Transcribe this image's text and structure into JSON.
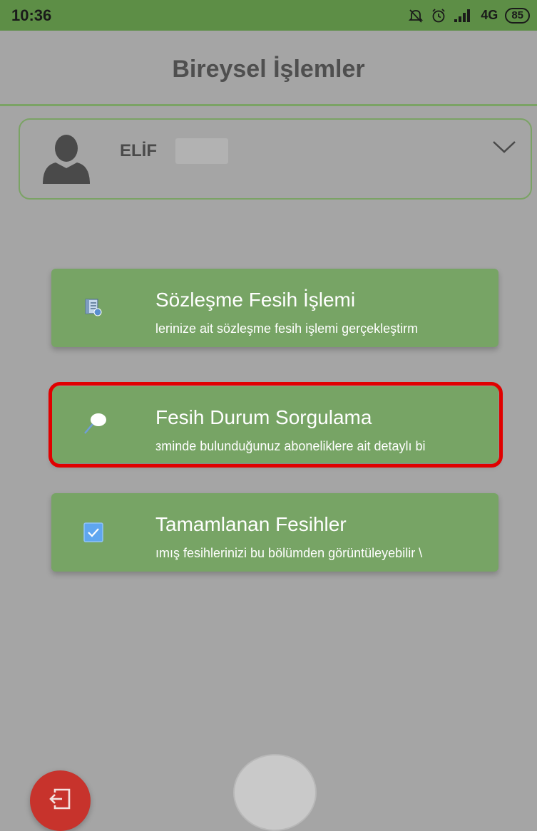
{
  "status_bar": {
    "time": "10:36",
    "network": "4G",
    "battery": "85"
  },
  "header": {
    "title": "Bireysel İşlemler"
  },
  "user": {
    "name": "ELİF"
  },
  "menu": {
    "items": [
      {
        "title": "Sözleşme Fesih İşlemi",
        "description": "lerinize ait sözleşme fesih işlemi gerçekleştirm",
        "icon": "document-list-icon"
      },
      {
        "title": "Fesih Durum Sorgulama",
        "description": "ᴈminde bulunduğunuz aboneliklere ait detaylı bi",
        "icon": "magnifier-icon"
      },
      {
        "title": "Tamamlanan Fesihler",
        "description": "ımış fesihlerinizi bu bölümden görüntüleyebilir \\",
        "icon": "checkbox-icon"
      }
    ]
  },
  "colors": {
    "status_bar": "#5d8e46",
    "accent": "#7ba365",
    "card": "#77a465",
    "highlight": "#e00000",
    "logout": "#c7332c"
  }
}
